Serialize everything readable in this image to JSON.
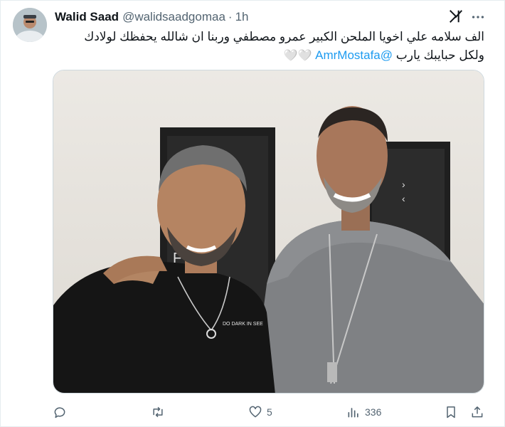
{
  "author": {
    "display_name": "Walid Saad",
    "handle": "@walidsaadgomaa",
    "separator": "·",
    "time": "1h"
  },
  "tweet": {
    "line1": "الف سلامه علي اخويا الملحن الكبير عمرو مصطفي وربنا ان شالله يحفظك لولادك",
    "line2_text": "ولكل حبايبك يارب",
    "mention": "@AmrMostafa",
    "emoji": "🤍🤍"
  },
  "media": {
    "shirt_print": "DO DARK IN SEE"
  },
  "actions": {
    "reply_count": "",
    "retweet_count": "",
    "like_count": "5",
    "views_count": "336"
  },
  "icons": {
    "grok": "grok-icon",
    "more": "more-icon",
    "reply": "reply-icon",
    "retweet": "retweet-icon",
    "like": "heart-icon",
    "views": "views-icon",
    "bookmark": "bookmark-icon",
    "share": "share-icon"
  },
  "colors": {
    "link": "#1d9bf0",
    "secondary_text": "#536471",
    "primary_text": "#0f1419"
  }
}
